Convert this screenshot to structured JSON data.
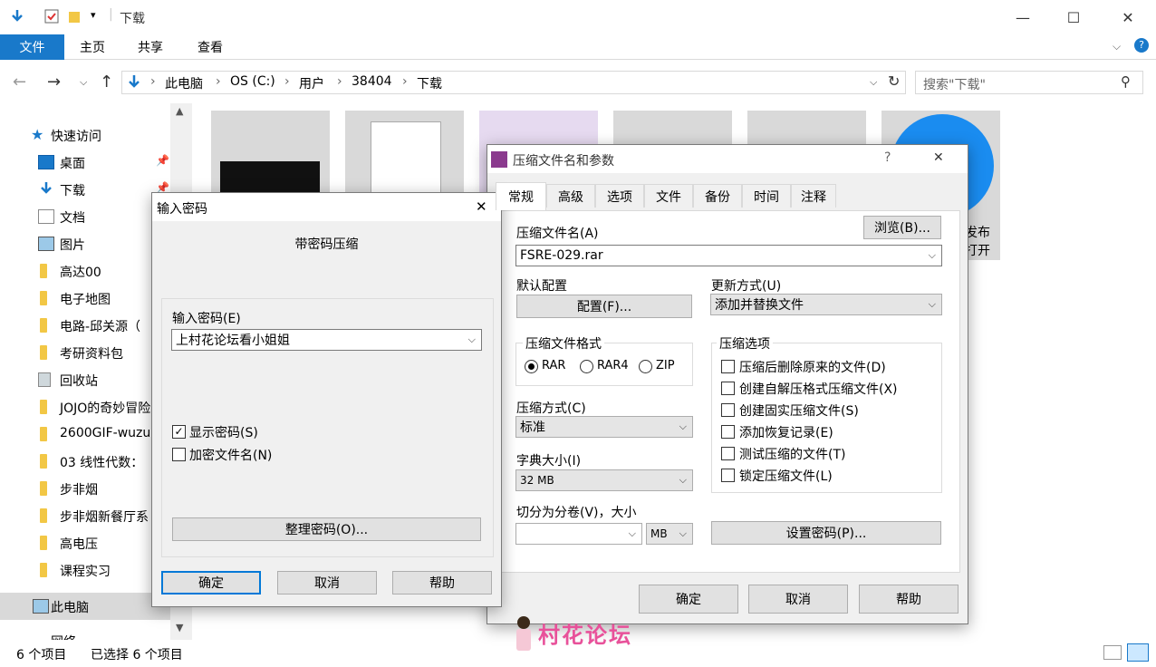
{
  "window": {
    "title": "下载"
  },
  "ribbon": {
    "tabs": [
      "文件",
      "主页",
      "共享",
      "查看"
    ]
  },
  "address": {
    "crumbs": [
      "此电脑",
      "OS (C:)",
      "用户",
      "38404",
      "下载"
    ]
  },
  "search": {
    "placeholder": "搜索\"下载\""
  },
  "sidebar": {
    "quick_access": "快速访问",
    "items": [
      "桌面",
      "下载",
      "文档",
      "图片",
      "高达00",
      "电子地图",
      "电路-邱关源（",
      "考研资料包",
      "回收站",
      "JOJO的奇妙冒险",
      "2600GIF-wuzu",
      "03 线性代数：",
      "步非烟",
      "步非烟新餐厅系",
      "高电压",
      "课程实习"
    ],
    "this_pc": "此电脑",
    "network": "网络"
  },
  "files": {
    "partial_text_1": "发布",
    "partial_text_2": "打开"
  },
  "status": {
    "count": "6 个项目",
    "selected": "已选择 6 个项目"
  },
  "pwd_dialog": {
    "title": "输入密码",
    "subtitle": "带密码压缩",
    "label": "输入密码(E)",
    "value": "上村花论坛看小姐姐",
    "show_pwd": "显示密码(S)",
    "encrypt_names": "加密文件名(N)",
    "organize": "整理密码(O)...",
    "ok": "确定",
    "cancel": "取消",
    "help": "帮助",
    "show_checked": true,
    "encrypt_checked": false
  },
  "rar_dialog": {
    "title": "压缩文件名和参数",
    "help_glyph": "?",
    "tabs": [
      "常规",
      "高级",
      "选项",
      "文件",
      "备份",
      "时间",
      "注释"
    ],
    "archive_name_label": "压缩文件名(A)",
    "browse": "浏览(B)...",
    "archive_name": "FSRE-029.rar",
    "profile_label": "默认配置",
    "profile_btn": "配置(F)...",
    "update_label": "更新方式(U)",
    "update_value": "添加并替换文件",
    "format_label": "压缩文件格式",
    "formats": [
      "RAR",
      "RAR4",
      "ZIP"
    ],
    "format_selected": "RAR",
    "method_label": "压缩方式(C)",
    "method_value": "标准",
    "dict_label": "字典大小(I)",
    "dict_value": "32 MB",
    "split_label": "切分为分卷(V)，大小",
    "split_unit": "MB",
    "options_label": "压缩选项",
    "options": [
      "压缩后删除原来的文件(D)",
      "创建自解压格式压缩文件(X)",
      "创建固实压缩文件(S)",
      "添加恢复记录(E)",
      "测试压缩的文件(T)",
      "锁定压缩文件(L)"
    ],
    "set_password": "设置密码(P)...",
    "ok": "确定",
    "cancel": "取消",
    "help": "帮助"
  },
  "watermark": {
    "text": "村花论坛"
  },
  "colors": {
    "accent": "#1979ca",
    "folder": "#f2c745",
    "watermark": "#e8519a"
  }
}
